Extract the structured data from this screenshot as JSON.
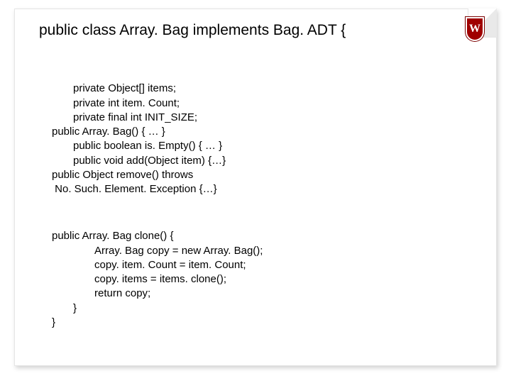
{
  "crest_letter": "W",
  "heading": "public class Array. Bag implements Bag. ADT {",
  "block1": {
    "l1": "private Object[] items;",
    "l2": "private int item. Count;",
    "l3": "private final int INIT_SIZE;",
    "l4": "public Array. Bag() { … }",
    "l5": "public boolean is. Empty() { … }",
    "l6": "public void add(Object item) {…}",
    "l7": "public Object remove() throws",
    "l8": " No. Such. Element. Exception {…}"
  },
  "block2": {
    "l1": "public Array. Bag clone() {",
    "l2": "Array. Bag copy = new Array. Bag();",
    "l3": "copy. item. Count = item. Count;",
    "l4": "copy. items = items. clone();",
    "l5": "return copy;",
    "l6": "}",
    "l7": "}"
  }
}
